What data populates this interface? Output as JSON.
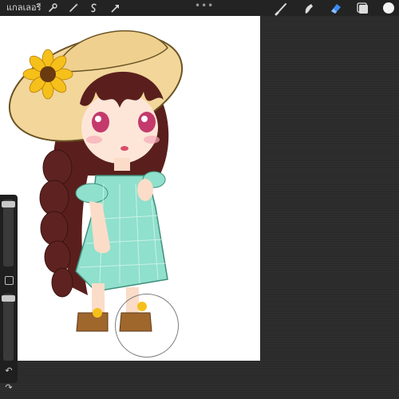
{
  "toolbar": {
    "gallery_label": "แกลเลอรี",
    "more_indicator": "•••",
    "left_icons": [
      "wrench-icon",
      "magic-wand-icon",
      "selection-icon",
      "transform-arrow-icon"
    ],
    "right_icons": [
      "brush-icon",
      "smudge-icon",
      "eraser-icon",
      "layers-icon"
    ],
    "active_tool": "eraser-icon",
    "accent_color": "#3b8bf5",
    "current_color": "#f4f4f4"
  },
  "sidebar": {
    "brush_size_level": 0.04,
    "opacity_level": 0.04,
    "icons": [
      "modify-square-icon",
      "undo-icon",
      "redo-icon"
    ],
    "undo_glyph": "↶",
    "redo_glyph": "↷"
  },
  "canvas": {
    "content": "chibi-girl-illustration",
    "background": "#ffffff"
  }
}
